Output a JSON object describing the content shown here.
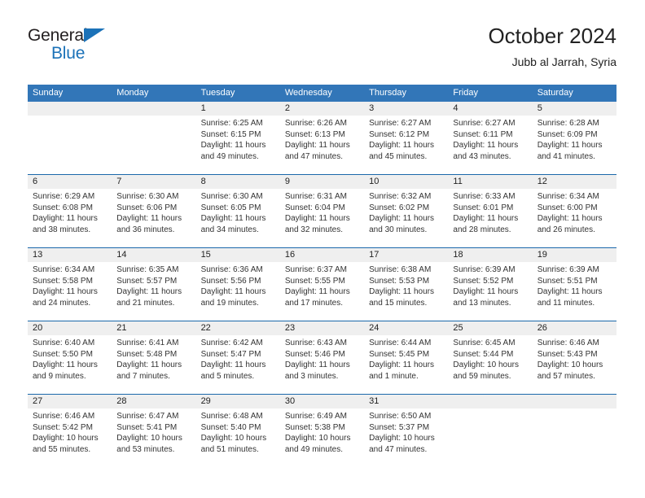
{
  "brand": {
    "name_top": "General",
    "name_bottom": "Blue",
    "triangle_color": "#1b72b8"
  },
  "header": {
    "title": "October 2024",
    "subtitle": "Jubb al Jarrah, Syria"
  },
  "colors": {
    "header_bar": "#3276b8",
    "week_rule": "#1b68ab",
    "daynum_band": "#efefef",
    "text": "#222222"
  },
  "weekdays": [
    "Sunday",
    "Monday",
    "Tuesday",
    "Wednesday",
    "Thursday",
    "Friday",
    "Saturday"
  ],
  "weeks": [
    [
      {
        "day": "",
        "lines": [
          "",
          "",
          "",
          ""
        ]
      },
      {
        "day": "",
        "lines": [
          "",
          "",
          "",
          ""
        ]
      },
      {
        "day": "1",
        "lines": [
          "Sunrise: 6:25 AM",
          "Sunset: 6:15 PM",
          "Daylight: 11 hours",
          "and 49 minutes."
        ]
      },
      {
        "day": "2",
        "lines": [
          "Sunrise: 6:26 AM",
          "Sunset: 6:13 PM",
          "Daylight: 11 hours",
          "and 47 minutes."
        ]
      },
      {
        "day": "3",
        "lines": [
          "Sunrise: 6:27 AM",
          "Sunset: 6:12 PM",
          "Daylight: 11 hours",
          "and 45 minutes."
        ]
      },
      {
        "day": "4",
        "lines": [
          "Sunrise: 6:27 AM",
          "Sunset: 6:11 PM",
          "Daylight: 11 hours",
          "and 43 minutes."
        ]
      },
      {
        "day": "5",
        "lines": [
          "Sunrise: 6:28 AM",
          "Sunset: 6:09 PM",
          "Daylight: 11 hours",
          "and 41 minutes."
        ]
      }
    ],
    [
      {
        "day": "6",
        "lines": [
          "Sunrise: 6:29 AM",
          "Sunset: 6:08 PM",
          "Daylight: 11 hours",
          "and 38 minutes."
        ]
      },
      {
        "day": "7",
        "lines": [
          "Sunrise: 6:30 AM",
          "Sunset: 6:06 PM",
          "Daylight: 11 hours",
          "and 36 minutes."
        ]
      },
      {
        "day": "8",
        "lines": [
          "Sunrise: 6:30 AM",
          "Sunset: 6:05 PM",
          "Daylight: 11 hours",
          "and 34 minutes."
        ]
      },
      {
        "day": "9",
        "lines": [
          "Sunrise: 6:31 AM",
          "Sunset: 6:04 PM",
          "Daylight: 11 hours",
          "and 32 minutes."
        ]
      },
      {
        "day": "10",
        "lines": [
          "Sunrise: 6:32 AM",
          "Sunset: 6:02 PM",
          "Daylight: 11 hours",
          "and 30 minutes."
        ]
      },
      {
        "day": "11",
        "lines": [
          "Sunrise: 6:33 AM",
          "Sunset: 6:01 PM",
          "Daylight: 11 hours",
          "and 28 minutes."
        ]
      },
      {
        "day": "12",
        "lines": [
          "Sunrise: 6:34 AM",
          "Sunset: 6:00 PM",
          "Daylight: 11 hours",
          "and 26 minutes."
        ]
      }
    ],
    [
      {
        "day": "13",
        "lines": [
          "Sunrise: 6:34 AM",
          "Sunset: 5:58 PM",
          "Daylight: 11 hours",
          "and 24 minutes."
        ]
      },
      {
        "day": "14",
        "lines": [
          "Sunrise: 6:35 AM",
          "Sunset: 5:57 PM",
          "Daylight: 11 hours",
          "and 21 minutes."
        ]
      },
      {
        "day": "15",
        "lines": [
          "Sunrise: 6:36 AM",
          "Sunset: 5:56 PM",
          "Daylight: 11 hours",
          "and 19 minutes."
        ]
      },
      {
        "day": "16",
        "lines": [
          "Sunrise: 6:37 AM",
          "Sunset: 5:55 PM",
          "Daylight: 11 hours",
          "and 17 minutes."
        ]
      },
      {
        "day": "17",
        "lines": [
          "Sunrise: 6:38 AM",
          "Sunset: 5:53 PM",
          "Daylight: 11 hours",
          "and 15 minutes."
        ]
      },
      {
        "day": "18",
        "lines": [
          "Sunrise: 6:39 AM",
          "Sunset: 5:52 PM",
          "Daylight: 11 hours",
          "and 13 minutes."
        ]
      },
      {
        "day": "19",
        "lines": [
          "Sunrise: 6:39 AM",
          "Sunset: 5:51 PM",
          "Daylight: 11 hours",
          "and 11 minutes."
        ]
      }
    ],
    [
      {
        "day": "20",
        "lines": [
          "Sunrise: 6:40 AM",
          "Sunset: 5:50 PM",
          "Daylight: 11 hours",
          "and 9 minutes."
        ]
      },
      {
        "day": "21",
        "lines": [
          "Sunrise: 6:41 AM",
          "Sunset: 5:48 PM",
          "Daylight: 11 hours",
          "and 7 minutes."
        ]
      },
      {
        "day": "22",
        "lines": [
          "Sunrise: 6:42 AM",
          "Sunset: 5:47 PM",
          "Daylight: 11 hours",
          "and 5 minutes."
        ]
      },
      {
        "day": "23",
        "lines": [
          "Sunrise: 6:43 AM",
          "Sunset: 5:46 PM",
          "Daylight: 11 hours",
          "and 3 minutes."
        ]
      },
      {
        "day": "24",
        "lines": [
          "Sunrise: 6:44 AM",
          "Sunset: 5:45 PM",
          "Daylight: 11 hours",
          "and 1 minute."
        ]
      },
      {
        "day": "25",
        "lines": [
          "Sunrise: 6:45 AM",
          "Sunset: 5:44 PM",
          "Daylight: 10 hours",
          "and 59 minutes."
        ]
      },
      {
        "day": "26",
        "lines": [
          "Sunrise: 6:46 AM",
          "Sunset: 5:43 PM",
          "Daylight: 10 hours",
          "and 57 minutes."
        ]
      }
    ],
    [
      {
        "day": "27",
        "lines": [
          "Sunrise: 6:46 AM",
          "Sunset: 5:42 PM",
          "Daylight: 10 hours",
          "and 55 minutes."
        ]
      },
      {
        "day": "28",
        "lines": [
          "Sunrise: 6:47 AM",
          "Sunset: 5:41 PM",
          "Daylight: 10 hours",
          "and 53 minutes."
        ]
      },
      {
        "day": "29",
        "lines": [
          "Sunrise: 6:48 AM",
          "Sunset: 5:40 PM",
          "Daylight: 10 hours",
          "and 51 minutes."
        ]
      },
      {
        "day": "30",
        "lines": [
          "Sunrise: 6:49 AM",
          "Sunset: 5:38 PM",
          "Daylight: 10 hours",
          "and 49 minutes."
        ]
      },
      {
        "day": "31",
        "lines": [
          "Sunrise: 6:50 AM",
          "Sunset: 5:37 PM",
          "Daylight: 10 hours",
          "and 47 minutes."
        ]
      },
      {
        "day": "",
        "lines": [
          "",
          "",
          "",
          ""
        ]
      },
      {
        "day": "",
        "lines": [
          "",
          "",
          "",
          ""
        ]
      }
    ]
  ]
}
